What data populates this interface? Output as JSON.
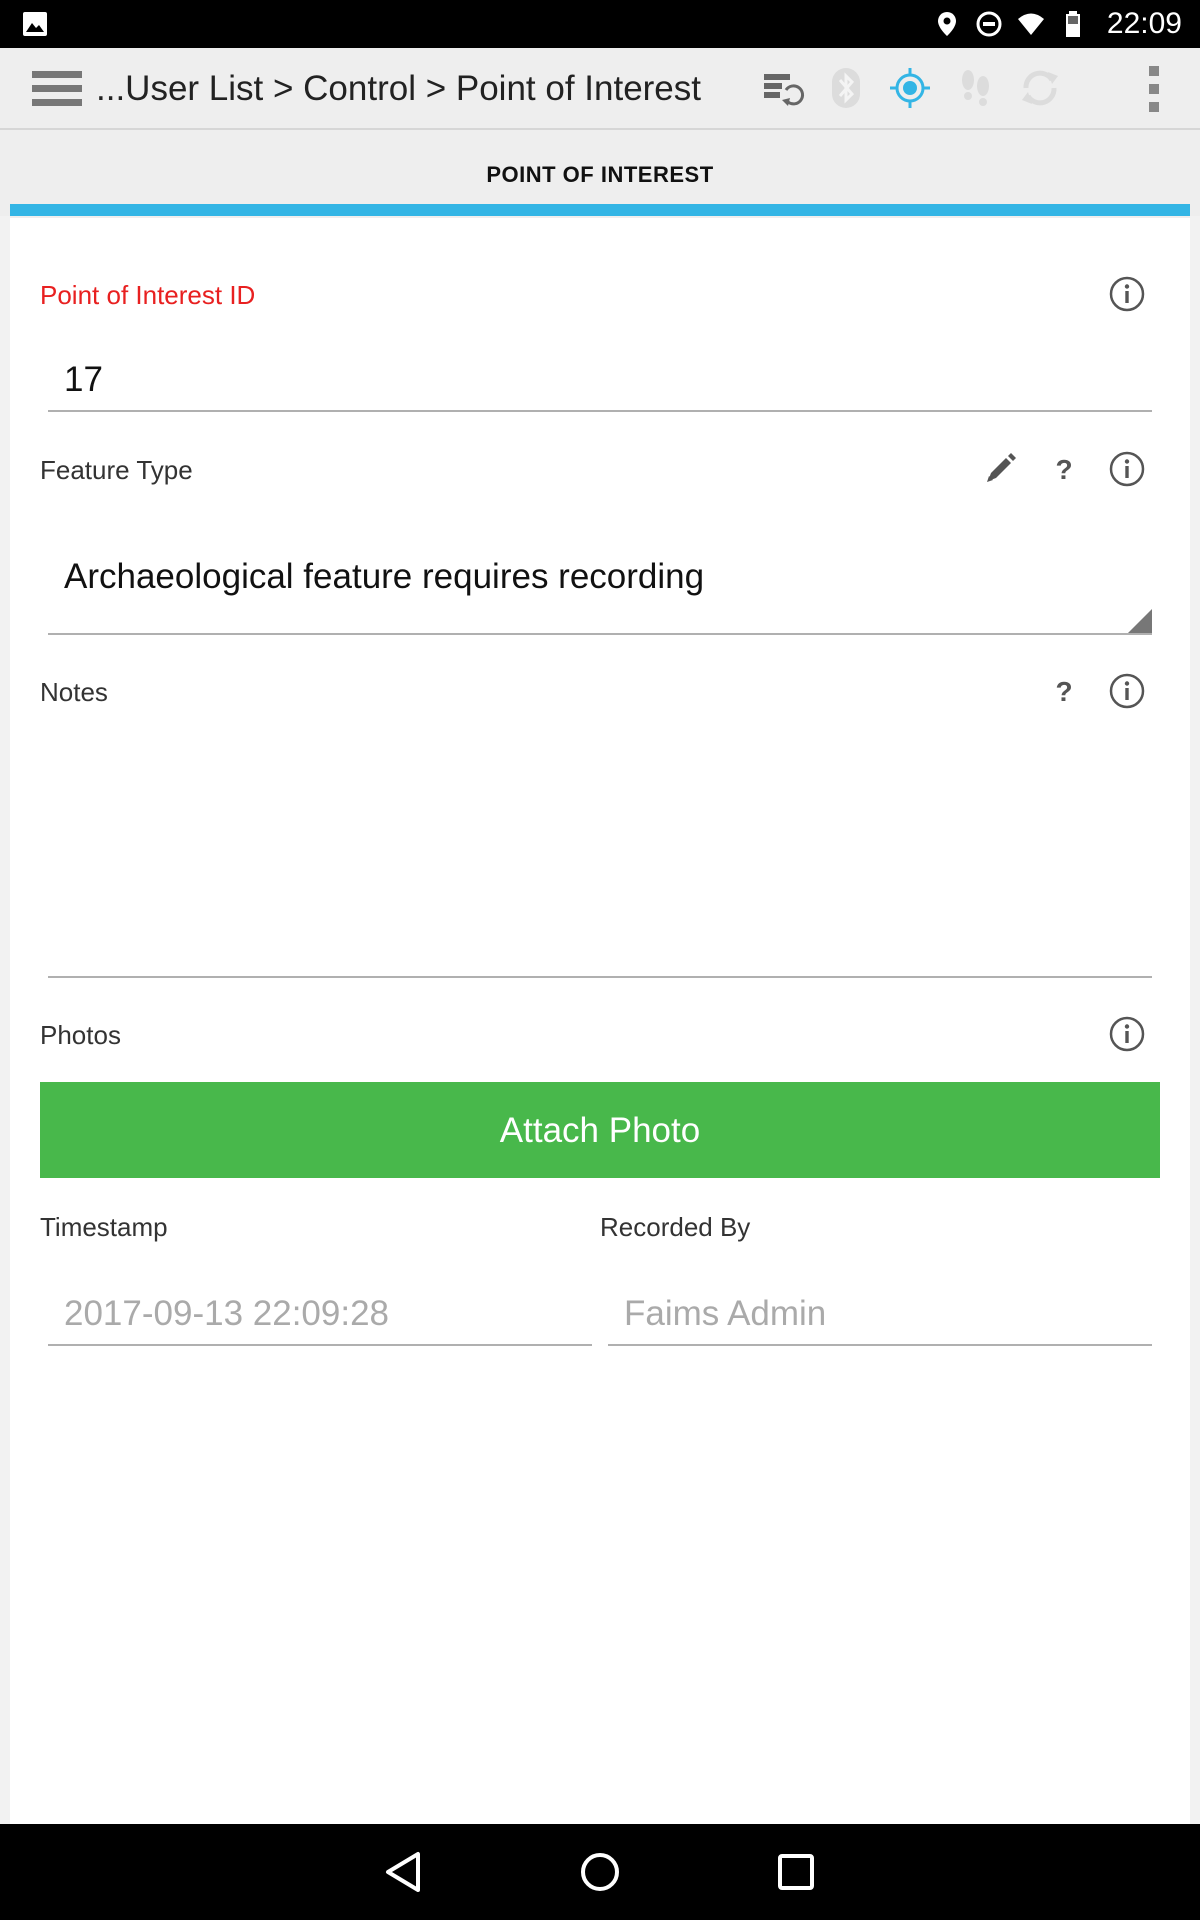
{
  "status_bar": {
    "time": "22:09",
    "icons": [
      "image-notification-icon",
      "location-icon",
      "do-not-disturb-icon",
      "wifi-icon",
      "battery-icon"
    ]
  },
  "app_bar": {
    "breadcrumb": "...User List > Control > Point of Interest",
    "icons": [
      "menu-icon",
      "sync-server-icon",
      "bluetooth-icon",
      "gps-icon",
      "tracking-footsteps-icon",
      "sync-icon",
      "overflow-menu-icon"
    ]
  },
  "tab": {
    "label": "POINT OF INTEREST"
  },
  "form": {
    "poi_id": {
      "label": "Point of Interest ID",
      "value": "17"
    },
    "feature_type": {
      "label": "Feature Type",
      "value": "Archaeological feature requires recording"
    },
    "notes": {
      "label": "Notes",
      "value": ""
    },
    "photos": {
      "label": "Photos",
      "button_label": "Attach Photo"
    },
    "timestamp": {
      "label": "Timestamp",
      "value": "2017-09-13 22:09:28"
    },
    "recorded_by": {
      "label": "Recorded By",
      "value": "Faims Admin"
    }
  },
  "colors": {
    "accent": "#33b5e5",
    "required_label": "#e82020",
    "attach_button": "#48b84b",
    "app_bar": "#eeeeee"
  }
}
